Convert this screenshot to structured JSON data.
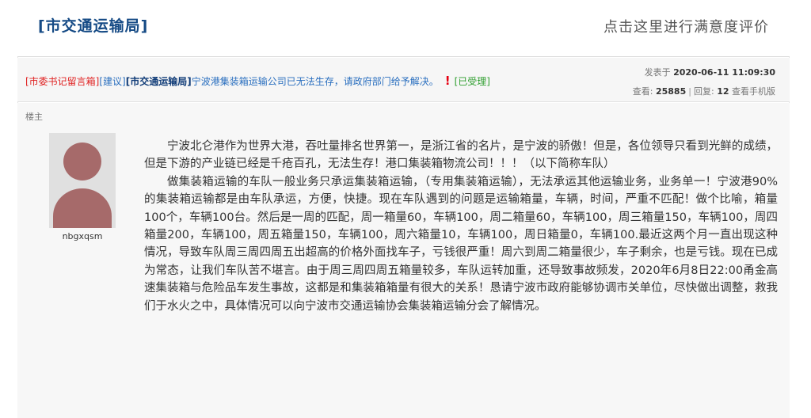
{
  "header": {
    "title": "[市交通运输局]",
    "rate_link": "点击这里进行满意度评价"
  },
  "thread": {
    "category1": "[市委书记留言箱]",
    "category2": "[建议]",
    "category3": "[市交通运输局]",
    "title": "宁波港集装箱运输公司已无法生存，请政府部门给予解决。",
    "urgent_mark": "!",
    "status": "[已受理]",
    "posted_label": "发表于",
    "posted_date": "2020-06-11 11:09:30",
    "views_label": "查看:",
    "views": "25885",
    "replies_label": "回复:",
    "replies": "12",
    "mobile_link": "查看手机版"
  },
  "post": {
    "floor_label": "楼主",
    "avatar_icon": "user-avatar-icon",
    "username": "nbgxqsm",
    "paragraphs": [
      "宁波北仑港作为世界大港，吞吐量排名世界第一，是浙江省的名片，是宁波的骄傲！但是，各位领导只看到光鲜的成绩，但是下游的产业链已经是千疮百孔，无法生存！港口集装箱物流公司！！！（以下简称车队）",
      "做集装箱运输的车队一般业务只承运集装箱运输，（专用集装箱运输），无法承运其他运输业务，业务单一！宁波港90%的集装箱运输都是由车队承运，方便，快捷。现在车队遇到的问题是运输箱量，车辆，时间，严重不匹配！做个比喻，箱量100个，车辆100台。然后是一周的匹配，周一箱量60，车辆100，周二箱量60，车辆100，周三箱量150，车辆100，周四箱量200，车辆100，周五箱量150，车辆100，周六箱量10，车辆100，周日箱量0，车辆100.最近这两个月一直出现这种情况，导致车队周三周四周五出超高的价格外面找车子，亏钱很严重！周六到周二箱量很少，车子剩余，也是亏钱。现在已成为常态，让我们车队苦不堪言。由于周三周四周五箱量较多，车队运转加重，还导致事故频发，2020年6月8日22:00甬金高速集装箱与危险品车发生事故，这都是和集装箱箱量有很大的关系！恳请宁波市政府能够协调市关单位，尽快做出调整，救我们于水火之中，具体情况可以向宁波市交通运输协会集装箱运输分会了解情况。"
    ]
  }
}
